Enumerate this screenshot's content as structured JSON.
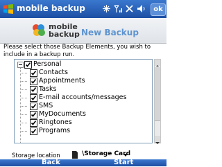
{
  "titlebar": {
    "title": "mobile backup",
    "ok_label": "ok"
  },
  "header": {
    "brand_line1": "mobile",
    "brand_line2": "backup",
    "page_title": "New Backup"
  },
  "instructions": "Please select those Backup Elements, you wish to include in a backup run.",
  "tree": {
    "root": {
      "label": "Personal",
      "checked": true
    },
    "items": [
      {
        "label": "Contacts",
        "checked": true
      },
      {
        "label": "Appointments",
        "checked": true
      },
      {
        "label": "Tasks",
        "checked": true
      },
      {
        "label": "E-mail accounts/messages",
        "checked": true
      },
      {
        "label": "SMS",
        "checked": true
      },
      {
        "label": "MyDocuments",
        "checked": true
      },
      {
        "label": "Ringtones",
        "checked": true
      },
      {
        "label": "Programs",
        "checked": true
      }
    ]
  },
  "storage": {
    "label": "Storage location",
    "value": "\\Storage Card"
  },
  "softkeys": {
    "left": "Back",
    "right": "Start"
  },
  "colors": {
    "titlebar": "#2a64bd",
    "accent_title": "#5e94d0"
  },
  "icons": [
    "windows-logo-icon",
    "connectivity-icon",
    "signal-icon",
    "volume-icon",
    "mobile-backup-logo-icon",
    "sd-card-icon"
  ]
}
